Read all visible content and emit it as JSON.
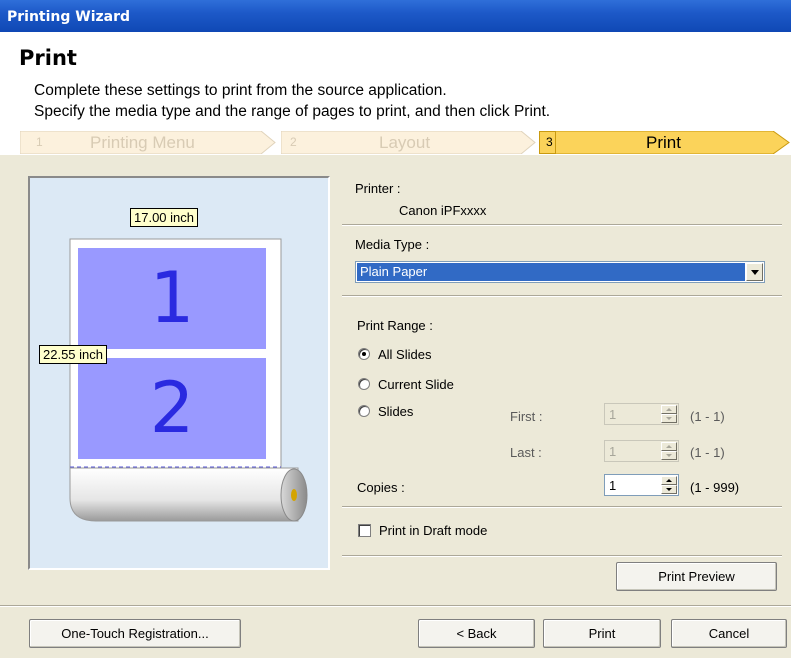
{
  "window": {
    "title": "Printing Wizard"
  },
  "header": {
    "title": "Print",
    "desc_line1": "Complete these settings to print from the source application.",
    "desc_line2": "Specify the media type and the range of pages to print, and then click Print."
  },
  "steps": [
    {
      "num": "1",
      "label": "Printing Menu",
      "active": false
    },
    {
      "num": "2",
      "label": "Layout",
      "active": false
    },
    {
      "num": "3",
      "label": "Print",
      "active": true
    }
  ],
  "preview": {
    "width_label": "17.00 inch",
    "height_label": "22.55 inch",
    "page1": "1",
    "page2": "2"
  },
  "printer": {
    "label": "Printer :",
    "value": "Canon iPFxxxx"
  },
  "media": {
    "label": "Media Type :",
    "value": "Plain Paper"
  },
  "range": {
    "label": "Print Range :",
    "options": [
      "All Slides",
      "Current Slide",
      "Slides"
    ],
    "selected": "All Slides",
    "first_label": "First :",
    "first_value": "1",
    "first_range": "(1 - 1)",
    "last_label": "Last :",
    "last_value": "1",
    "last_range": "(1 - 1)"
  },
  "copies": {
    "label": "Copies :",
    "value": "1",
    "range": "(1 - 999)"
  },
  "draft": {
    "label": "Print in Draft mode",
    "checked": false
  },
  "buttons": {
    "preview": "Print Preview",
    "registration": "One-Touch Registration...",
    "back": "< Back",
    "print": "Print",
    "cancel": "Cancel"
  },
  "colors": {
    "titlebar": "#1d59c8",
    "step_active": "#fbd35a",
    "step_dim": "#fcf1dd",
    "page_fill": "#9999ff",
    "preview_bg": "#dce9f5",
    "selection": "#316ac5"
  }
}
